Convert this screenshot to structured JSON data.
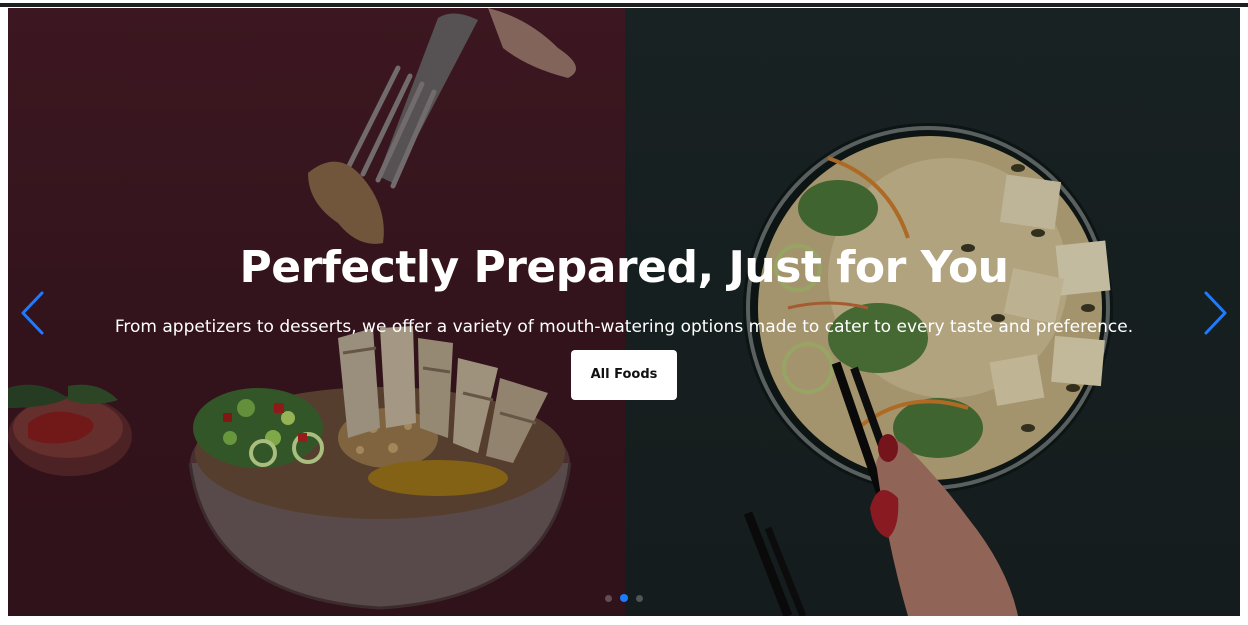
{
  "hero": {
    "headline": "Perfectly Prepared, Just for You",
    "subline": "From appetizers to desserts, we offer a variety of mouth-watering options made to cater to every taste and preference.",
    "cta_label": "All Foods"
  },
  "carousel": {
    "prev_icon": "chevron-left-icon",
    "next_icon": "chevron-right-icon",
    "slide_count": 3,
    "active_index": 1
  },
  "colors": {
    "left_panel": "#4a1d29",
    "right_panel": "#1f2a2b",
    "accent": "#1e7bff",
    "button_bg": "#ffffff"
  }
}
